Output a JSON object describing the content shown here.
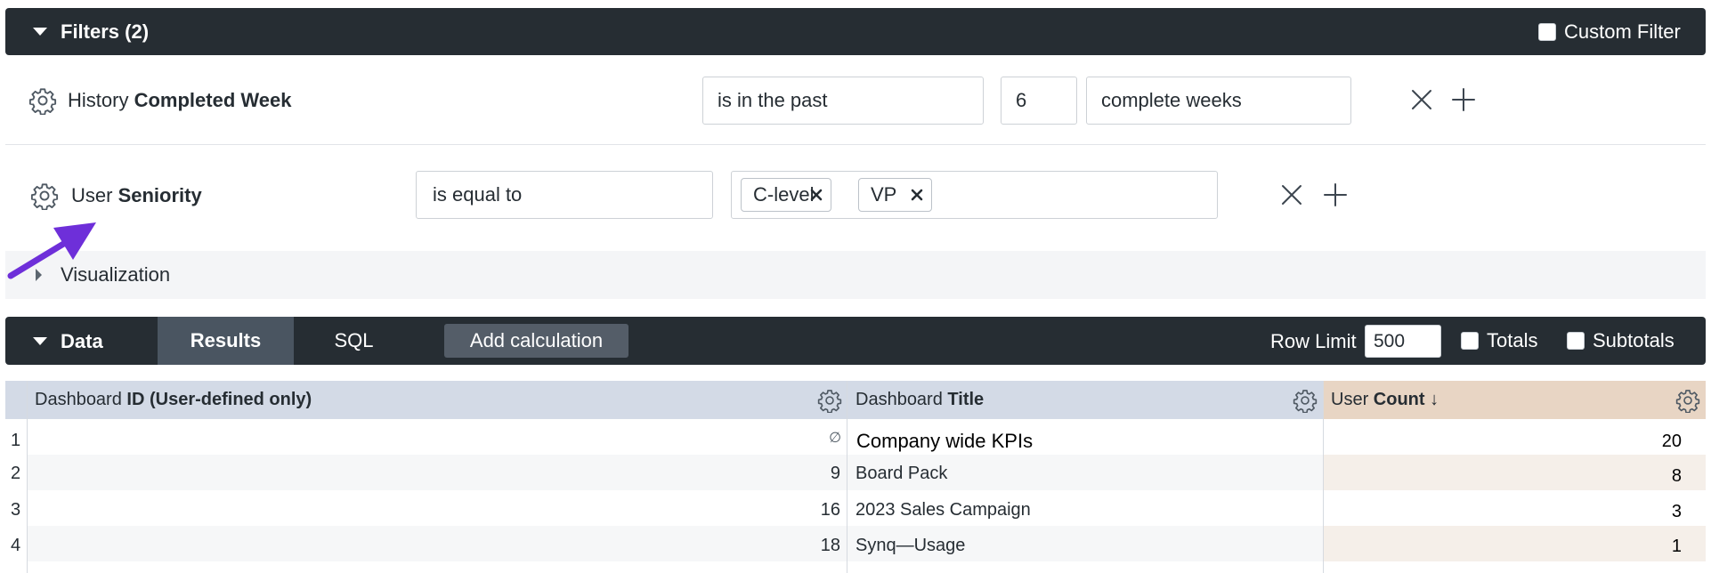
{
  "filters_bar": {
    "title": "Filters (2)",
    "custom_filter_label": "Custom Filter"
  },
  "filters": [
    {
      "field_group": "History",
      "field_name": "Completed Week",
      "operator": "is in the past",
      "value": "6",
      "unit": "complete weeks"
    },
    {
      "field_group": "User",
      "field_name": "Seniority",
      "operator": "is equal to",
      "chips": [
        "C-level",
        "VP"
      ]
    }
  ],
  "visualization": {
    "title": "Visualization"
  },
  "data_bar": {
    "title": "Data",
    "tabs": [
      "Results",
      "SQL"
    ],
    "active_tab": "Results",
    "add_calculation_label": "Add calculation",
    "row_limit_label": "Row Limit",
    "row_limit_value": "500",
    "totals_label": "Totals",
    "subtotals_label": "Subtotals"
  },
  "table": {
    "columns": [
      {
        "group": "Dashboard",
        "name": "ID (User-defined only)"
      },
      {
        "group": "Dashboard",
        "name": "Title"
      },
      {
        "group": "User",
        "name": "Count ↓"
      }
    ],
    "rows": [
      {
        "num": "1",
        "id": "∅",
        "title": "Company wide KPIs",
        "count": "20"
      },
      {
        "num": "2",
        "id": "9",
        "title": "Board Pack",
        "count": "8"
      },
      {
        "num": "3",
        "id": "16",
        "title": "2023 Sales Campaign",
        "count": "3"
      },
      {
        "num": "4",
        "id": "18",
        "title": "Synq—Usage",
        "count": "1"
      }
    ]
  },
  "colors": {
    "header_bar": "#262d33",
    "dimension_header": "#d3dae6",
    "measure_header": "#e8d5c4",
    "arrow": "#6e2fd9"
  }
}
